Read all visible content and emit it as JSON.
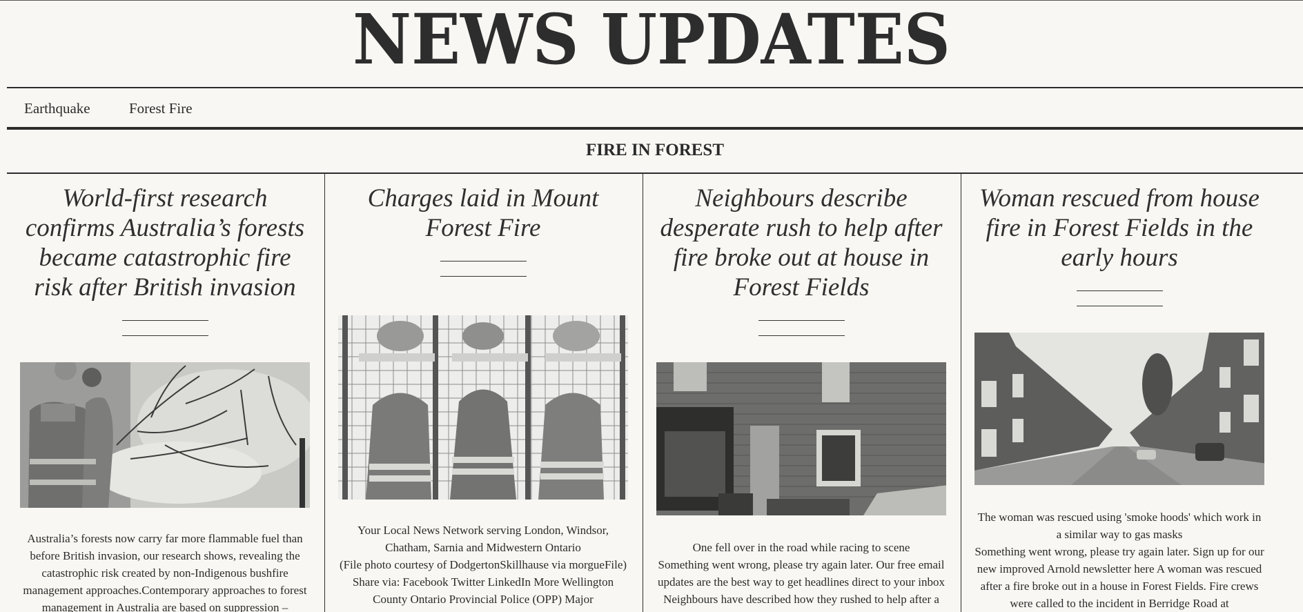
{
  "masthead": {
    "title": "NEWS UPDATES"
  },
  "nav": {
    "items": [
      "Earthquake",
      "Forest Fire"
    ]
  },
  "section": {
    "title": "FIRE IN FOREST"
  },
  "articles": [
    {
      "headline": "World-first research confirms Australia’s forests became catastrophic fire risk after British invasion",
      "image": "firefighters-spraying-bushfire",
      "body": "Australia’s forests now carry far more flammable fuel than before British invasion, our research shows, revealing the catastrophic risk created by non-Indigenous bushfire management approaches.Contemporary approaches to forest management in Australia are based on suppression –"
    },
    {
      "headline": "Charges laid in Mount Forest Fire",
      "image": "fire-and-ems-coats-on-rack",
      "body": "Your Local News Network serving London, Windsor, Chatham, Sarnia and Midwestern Ontario\n(File photo courtesy of DodgertonSkillhause via morgueFile) Share via: Facebook Twitter LinkedIn More Wellington County Ontario Provincial Police (OPP) Major"
    },
    {
      "headline": "Neighbours describe desperate rush to help after fire broke out at house in Forest Fields",
      "image": "brick-house-with-shop-front",
      "body": "One fell over in the road while racing to scene\nSomething went wrong, please try again later. Our free email updates are the best way to get headlines direct to your inbox Neighbours have described how they rushed to help after a woman was trapped in a house fire"
    },
    {
      "headline": "Woman rescued from house fire in Forest Fields in the early hours",
      "image": "terraced-street-houses",
      "body": "The woman was rescued using 'smoke hoods' which work in a similar way to gas masks\nSomething went wrong, please try again later. Sign up for our new improved Arnold newsletter here A woman was rescued after a fire broke out in a house in Forest Fields. Fire crews were called to the incident in Berridge Road at"
    }
  ]
}
